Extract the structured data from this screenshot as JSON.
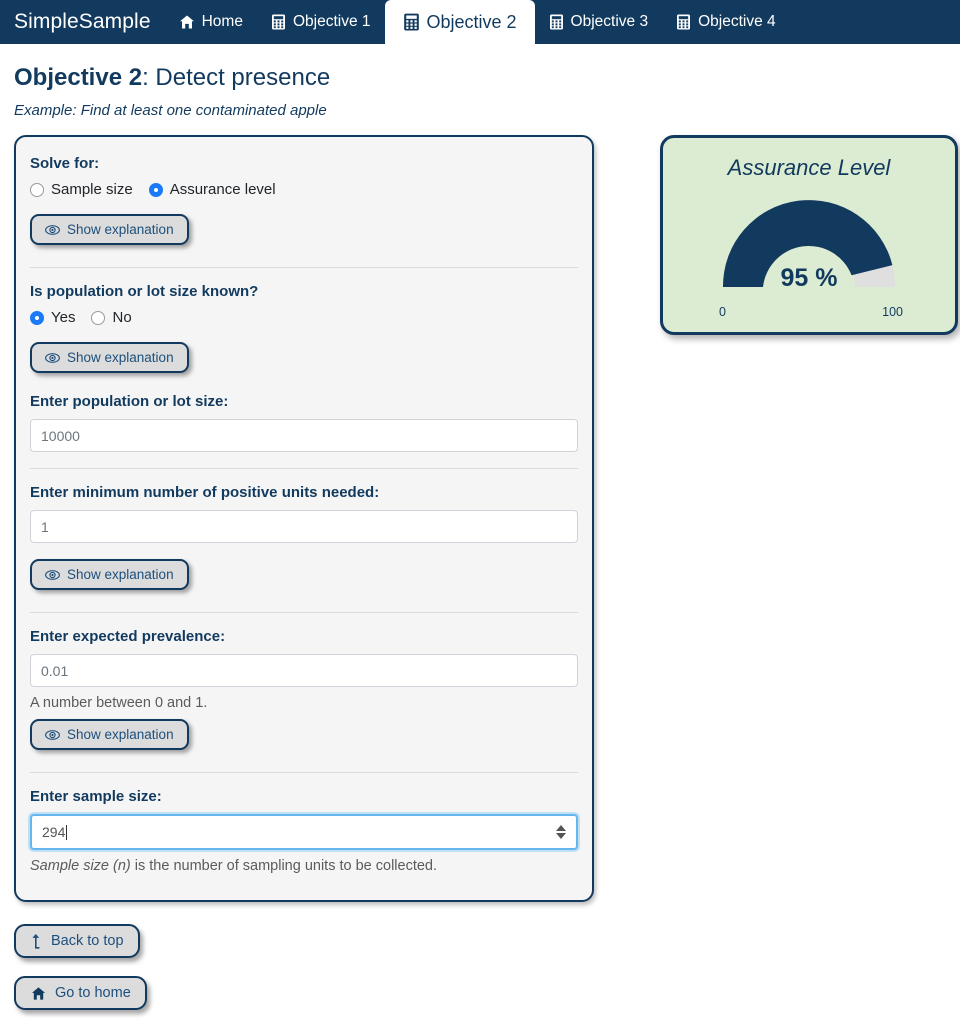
{
  "navbar": {
    "brand": "SimpleSample",
    "items": [
      {
        "label": "Home",
        "icon": "home-icon",
        "active": false
      },
      {
        "label": "Objective 1",
        "icon": "calculator-icon",
        "active": false
      },
      {
        "label": "Objective 2",
        "icon": "calculator-icon",
        "active": true
      },
      {
        "label": "Objective 3",
        "icon": "calculator-icon",
        "active": false
      },
      {
        "label": "Objective 4",
        "icon": "calculator-icon",
        "active": false
      }
    ]
  },
  "header": {
    "title_strong": "Objective 2",
    "title_rest": ": Detect presence",
    "subtitle": "Example: Find at least one contaminated apple"
  },
  "form": {
    "solve_for": {
      "label": "Solve for:",
      "options": [
        {
          "label": "Sample size",
          "selected": false
        },
        {
          "label": "Assurance level",
          "selected": true
        }
      ],
      "explain_label": "Show explanation"
    },
    "population_known": {
      "label": "Is population or lot size known?",
      "options": [
        {
          "label": "Yes",
          "selected": true
        },
        {
          "label": "No",
          "selected": false
        }
      ],
      "explain_label": "Show explanation"
    },
    "population_size": {
      "label": "Enter population or lot size:",
      "value": "10000"
    },
    "positive_units": {
      "label": "Enter minimum number of positive units needed:",
      "value": "1",
      "explain_label": "Show explanation"
    },
    "prevalence": {
      "label": "Enter expected prevalence:",
      "value": "0.01",
      "helper": "A number between 0 and 1.",
      "explain_label": "Show explanation"
    },
    "sample_size": {
      "label": "Enter sample size:",
      "value": "294",
      "helper_em": "Sample size (n)",
      "helper_rest": " is the number of sampling units to be collected."
    }
  },
  "gauge": {
    "title": "Assurance Level",
    "value_text": "95 %",
    "min_label": "0",
    "max_label": "100"
  },
  "chart_data": {
    "type": "gauge",
    "title": "Assurance Level",
    "value": 95,
    "unit": "%",
    "min": 0,
    "max": 100,
    "tick_labels": [
      "0",
      "100"
    ],
    "fill_color": "#123A5E",
    "track_color": "#dfdfdf",
    "background_color": "#dcecd2"
  },
  "footer": {
    "back_to_top": "Back to top",
    "go_to_home": "Go to home"
  }
}
